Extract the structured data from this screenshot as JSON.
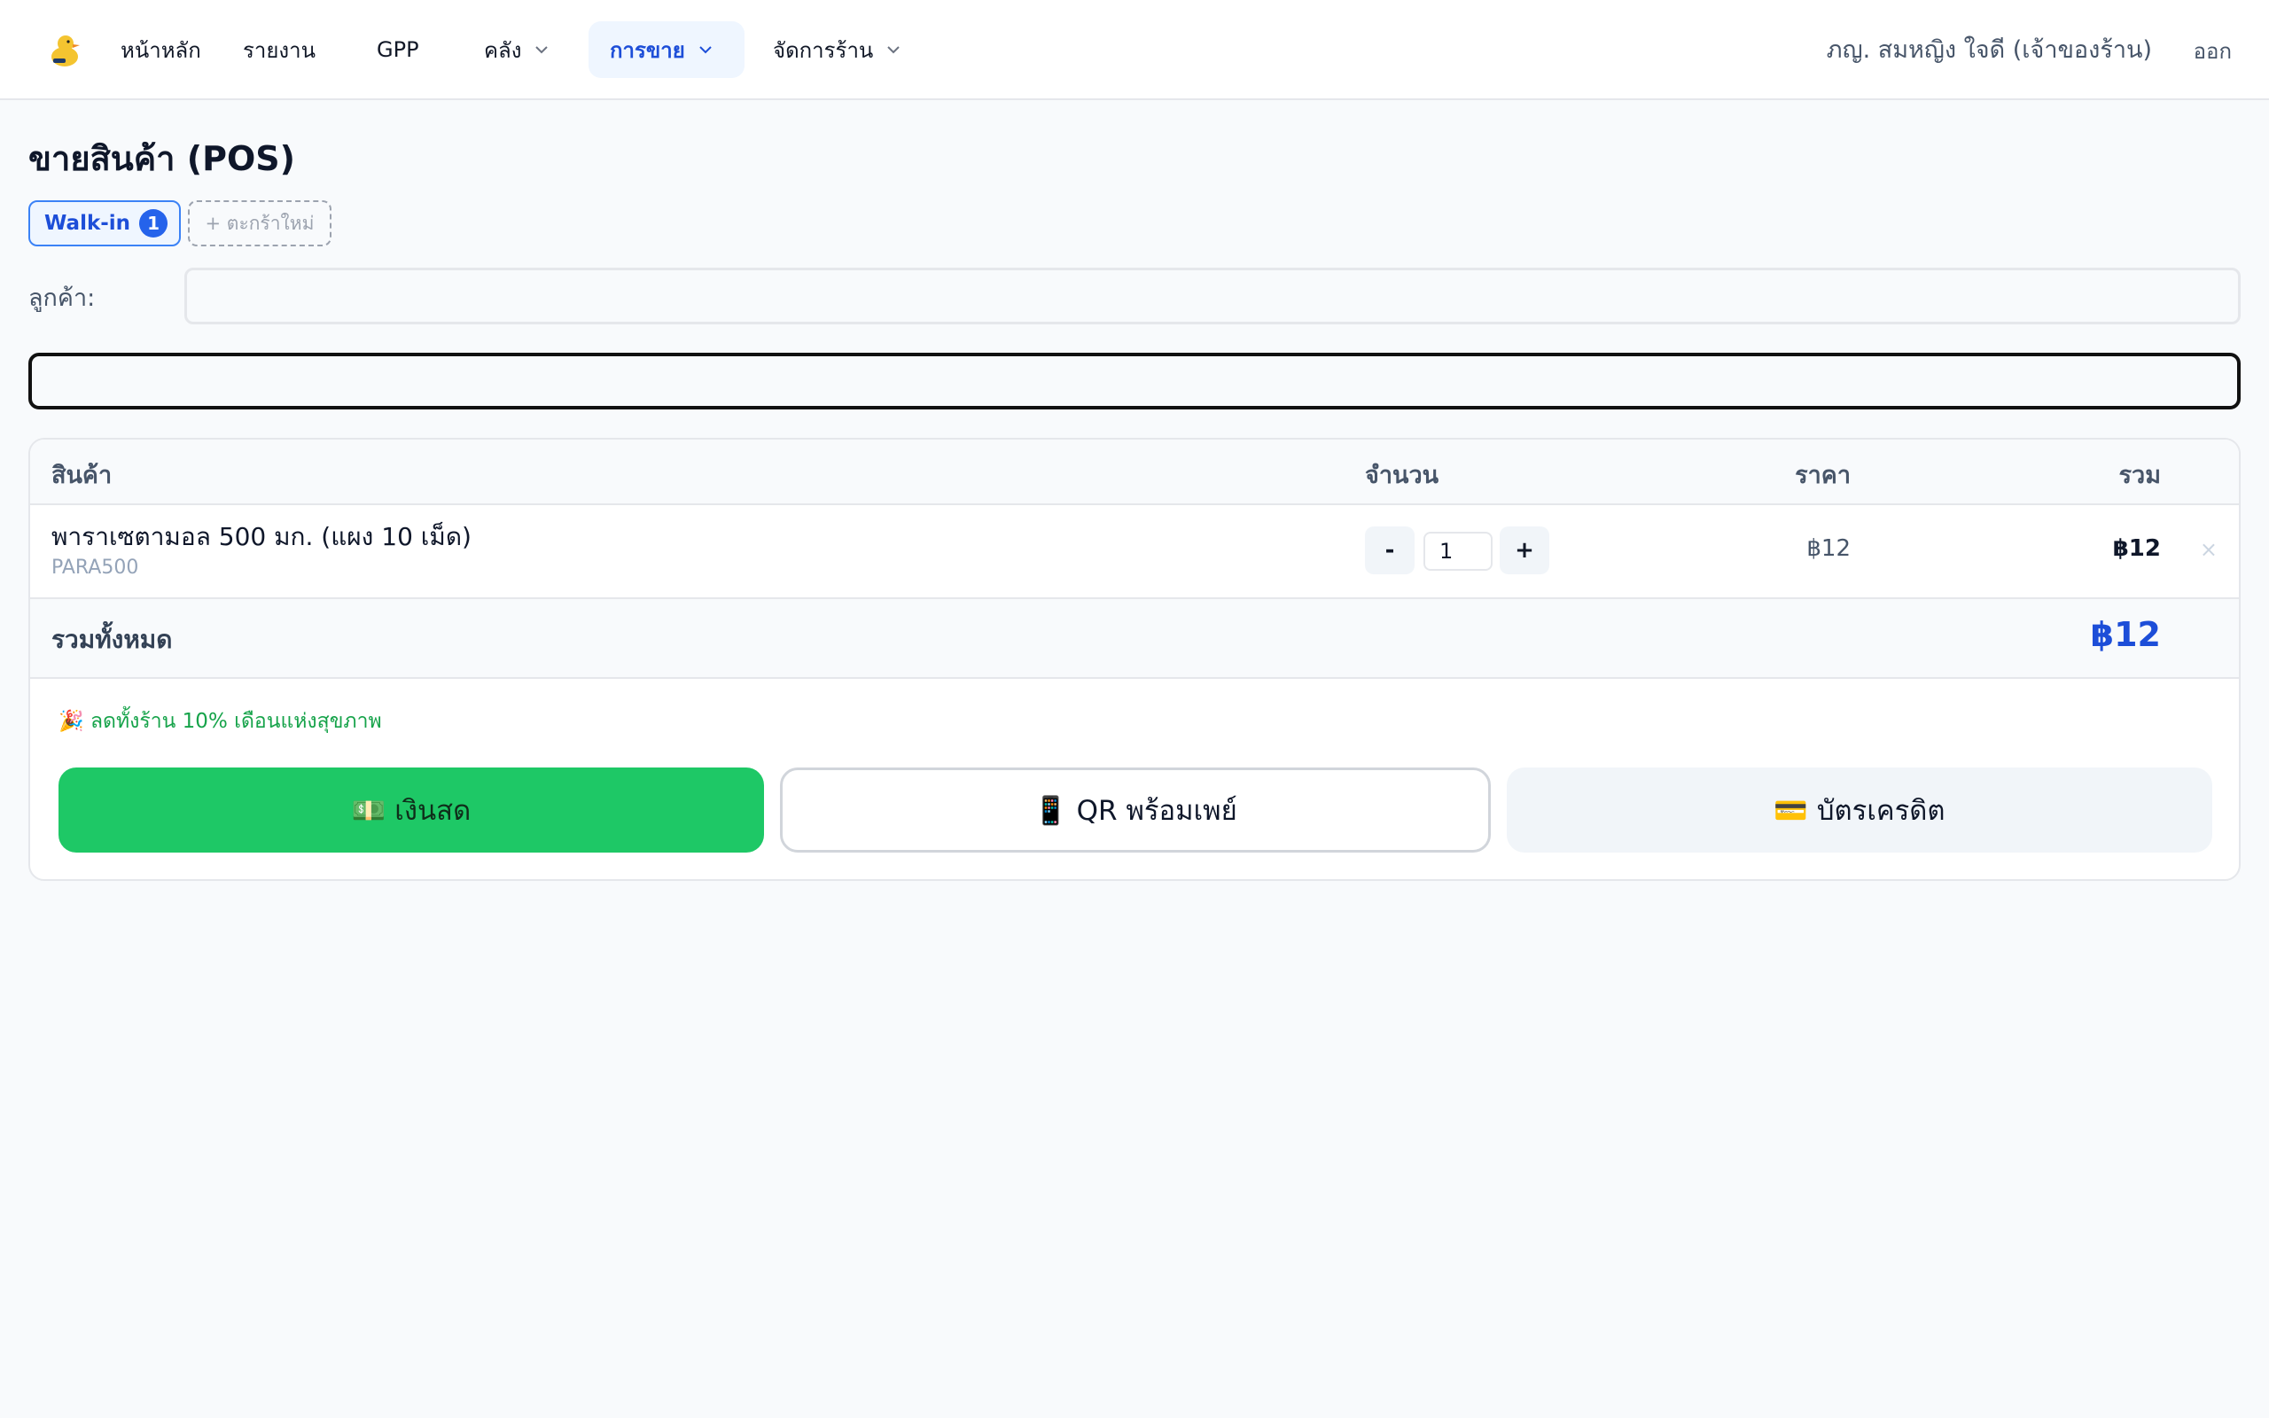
{
  "nav": {
    "items": [
      {
        "label": "หน้าหลัก"
      },
      {
        "label": "รายงาน"
      },
      {
        "label": "GPP"
      },
      {
        "label": "คลัง"
      },
      {
        "label": "การขาย"
      },
      {
        "label": "จัดการร้าน"
      }
    ],
    "user": "ภญ. สมหญิง ใจดี (เจ้าของร้าน)",
    "logout": "ออก"
  },
  "page": {
    "title": "ขายสินค้า (POS)",
    "cart_tab": {
      "label": "Walk-in",
      "count": "1"
    },
    "new_cart": "+ ตะกร้าใหม่",
    "customer_label": "ลูกค้า:",
    "customer_value": "",
    "search_value": ""
  },
  "table": {
    "headers": {
      "product": "สินค้า",
      "qty": "จำนวน",
      "price": "ราคา",
      "total": "รวม"
    },
    "rows": [
      {
        "name": "พาราเซตามอล 500 มก. (แผง 10 เม็ด)",
        "sku": "PARA500",
        "minus": "-",
        "qty": "1",
        "plus": "+",
        "price": "฿12",
        "total": "฿12",
        "remove": "×"
      }
    ],
    "grand_total_label": "รวมทั้งหมด",
    "grand_total": "฿12"
  },
  "promo": "🎉 ลดทั้งร้าน 10% เดือนแห่งสุขภาพ",
  "payment": {
    "cash": "💵 เงินสด",
    "qr": "📱 QR พร้อมเพย์",
    "card": "💳 บัตรเครดิต"
  },
  "colors": {
    "accent": "#1d4ed8",
    "cash_green": "#1ec866",
    "promo_green": "#16a34a"
  }
}
